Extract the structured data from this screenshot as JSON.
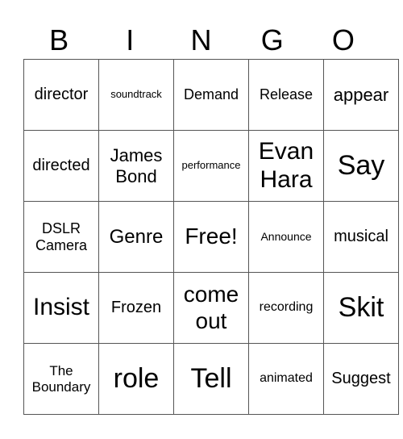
{
  "header": [
    "B",
    "I",
    "N",
    "G",
    "O"
  ],
  "cells": [
    [
      "director",
      "soundtrack",
      "Demand",
      "Release",
      "appear"
    ],
    [
      "directed",
      "James Bond",
      "performance",
      "Evan Hara",
      "Say"
    ],
    [
      "DSLR Camera",
      "Genre",
      "Free!",
      "Announce",
      "musical"
    ],
    [
      "Insist",
      "Frozen",
      "come out",
      "recording",
      "Skit"
    ],
    [
      "The Boundary",
      "role",
      "Tell",
      "animated",
      "Suggest"
    ]
  ]
}
